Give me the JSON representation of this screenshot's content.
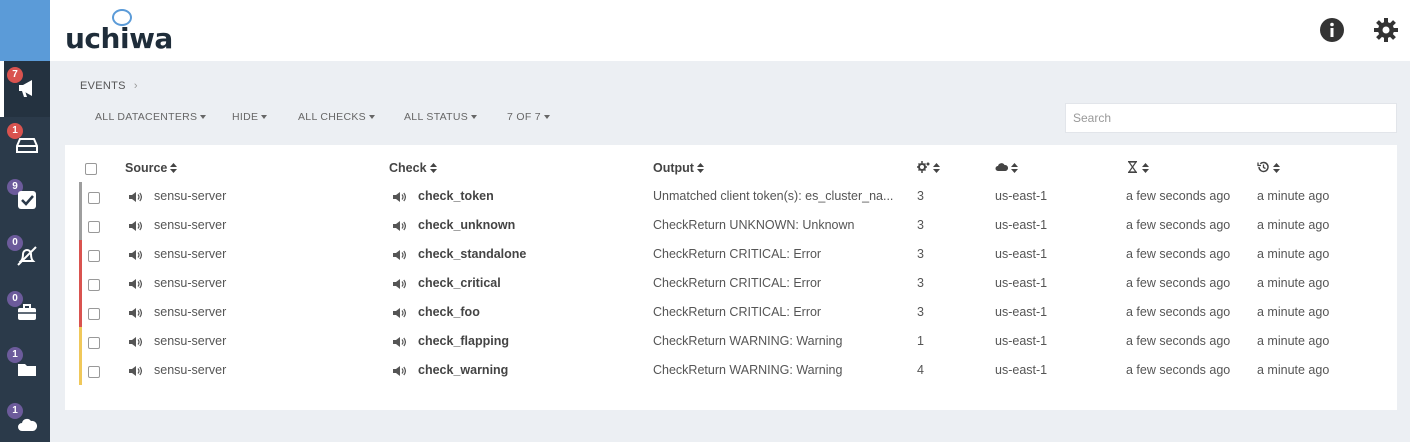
{
  "app": {
    "logo_text": "uchiwa"
  },
  "colors": {
    "sidebar": "#2b3a4a",
    "accent": "#5b9bd8",
    "critical": "#d9534f",
    "warning": "#f0c85a",
    "unknown": "#9e9e9e",
    "badge_purple": "#6c5b9b"
  },
  "sidebar": {
    "items": [
      {
        "icon": "megaphone-icon",
        "badge": "7",
        "badge_color": "red",
        "active": true
      },
      {
        "icon": "inbox-icon",
        "badge": "1",
        "badge_color": "red"
      },
      {
        "icon": "check-square-icon",
        "badge": "9",
        "badge_color": "purple"
      },
      {
        "icon": "silence-icon",
        "badge": "0",
        "badge_color": "purple"
      },
      {
        "icon": "briefcase-icon",
        "badge": "0",
        "badge_color": "purple"
      },
      {
        "icon": "folder-icon",
        "badge": "1",
        "badge_color": "purple"
      },
      {
        "icon": "cloud-icon",
        "badge": "1",
        "badge_color": "purple"
      }
    ]
  },
  "header": {
    "info_icon": "info-icon",
    "settings_icon": "gear-icon"
  },
  "breadcrumb": {
    "label": "EVENTS",
    "sep": "›"
  },
  "filters": {
    "datacenters": "ALL DATACENTERS",
    "hide": "HIDE",
    "checks": "ALL CHECKS",
    "status": "ALL STATUS",
    "pagination": "7 OF 7"
  },
  "search": {
    "placeholder": "Search",
    "value": ""
  },
  "table": {
    "headers": {
      "source": "Source",
      "check": "Check",
      "output": "Output"
    },
    "header_icons": [
      "occurrences-icon",
      "cloud-icon",
      "hourglass-icon",
      "history-icon"
    ],
    "rows": [
      {
        "status": "unknown",
        "source": "sensu-server",
        "check": "check_token",
        "output": "Unmatched client token(s): es_cluster_na...",
        "occurrences": "3",
        "datacenter": "us-east-1",
        "issued": "a few seconds ago",
        "last_state_change": "a minute ago"
      },
      {
        "status": "unknown",
        "source": "sensu-server",
        "check": "check_unknown",
        "output": "CheckReturn UNKNOWN: Unknown",
        "occurrences": "3",
        "datacenter": "us-east-1",
        "issued": "a few seconds ago",
        "last_state_change": "a minute ago"
      },
      {
        "status": "critical",
        "source": "sensu-server",
        "check": "check_standalone",
        "output": "CheckReturn CRITICAL: Error",
        "occurrences": "3",
        "datacenter": "us-east-1",
        "issued": "a few seconds ago",
        "last_state_change": "a minute ago"
      },
      {
        "status": "critical",
        "source": "sensu-server",
        "check": "check_critical",
        "output": "CheckReturn CRITICAL: Error",
        "occurrences": "3",
        "datacenter": "us-east-1",
        "issued": "a few seconds ago",
        "last_state_change": "a minute ago"
      },
      {
        "status": "critical",
        "source": "sensu-server",
        "check": "check_foo",
        "output": "CheckReturn CRITICAL: Error",
        "occurrences": "3",
        "datacenter": "us-east-1",
        "issued": "a few seconds ago",
        "last_state_change": "a minute ago"
      },
      {
        "status": "warning",
        "source": "sensu-server",
        "check": "check_flapping",
        "output": "CheckReturn WARNING: Warning",
        "occurrences": "1",
        "datacenter": "us-east-1",
        "issued": "a few seconds ago",
        "last_state_change": "a minute ago"
      },
      {
        "status": "warning",
        "source": "sensu-server",
        "check": "check_warning",
        "output": "CheckReturn WARNING: Warning",
        "occurrences": "4",
        "datacenter": "us-east-1",
        "issued": "a few seconds ago",
        "last_state_change": "a minute ago"
      }
    ]
  }
}
